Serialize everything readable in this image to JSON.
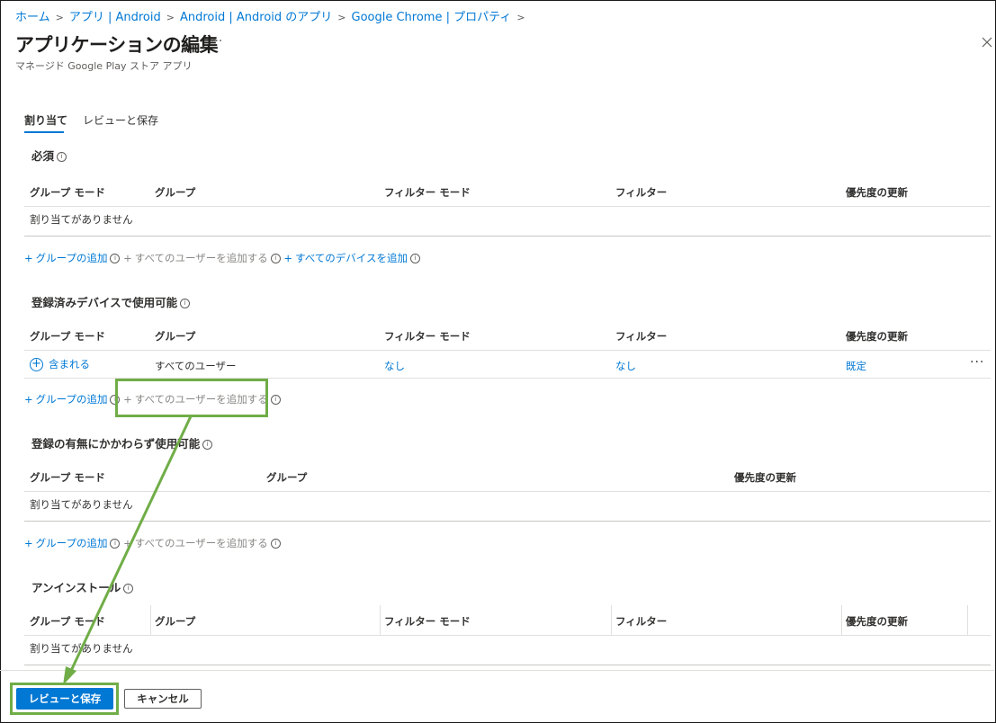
{
  "breadcrumb": [
    "ホーム",
    "アプリ | Android",
    "Android | Android のアプリ",
    "Google Chrome | プロパティ"
  ],
  "header": {
    "title": "アプリケーションの編集",
    "more": "···",
    "subtitle": "マネージド Google Play ストア アプリ"
  },
  "tabs": [
    "割り当て",
    "レビューと保存"
  ],
  "columns": {
    "group_mode": "グループ モード",
    "group": "グループ",
    "filter_mode": "フィルター モード",
    "filter": "フィルター",
    "priority": "優先度の更新"
  },
  "sections": {
    "required": {
      "title": "必須",
      "empty": "割り当てがありません"
    },
    "available_enrolled": {
      "title": "登録済みデバイスで使用可能",
      "row": {
        "group_mode": "含まれる",
        "group": "すべてのユーザー",
        "filter_mode": "なし",
        "filter": "なし",
        "priority": "既定",
        "more": "···"
      }
    },
    "available_any": {
      "title": "登録の有無にかかわらず使用可能",
      "empty": "割り当てがありません"
    },
    "uninstall": {
      "title": "アンインストール",
      "empty": "割り当てがありません"
    }
  },
  "actions": {
    "add_group": "グループの追加",
    "add_all_users": "すべてのユーザーを追加する",
    "add_all_devices": "すべてのデバイスを追加"
  },
  "footer": {
    "review_save": "レビューと保存",
    "cancel": "キャンセル"
  },
  "colors": {
    "accent": "#0078d4",
    "annotation": "#70ad47"
  }
}
